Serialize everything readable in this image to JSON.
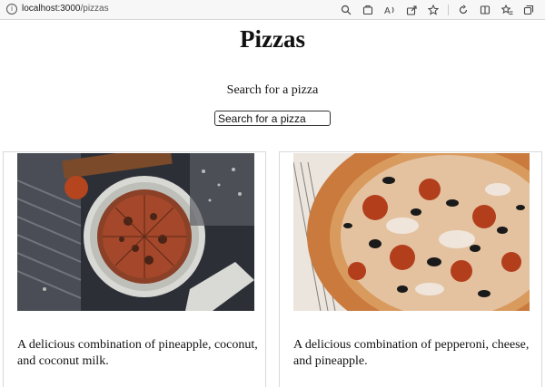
{
  "browser": {
    "url_host": "localhost:3000",
    "url_path": "/pizzas",
    "icons": [
      "zoom-icon",
      "extensions-icon",
      "read-aloud-icon",
      "share-icon",
      "favorite-icon",
      "refresh-icon",
      "split-screen-icon",
      "favorites-icon",
      "collections-icon"
    ]
  },
  "page": {
    "title": "Pizzas",
    "search_label": "Search for a pizza",
    "search_placeholder": "Search for a pizza",
    "search_value": ""
  },
  "pizzas": [
    {
      "description": "A delicious combination of pineapple, coconut, and coconut milk."
    },
    {
      "description": "A delicious combination of pepperoni, cheese, and pineapple."
    }
  ],
  "colors": {
    "background": "#ffffff",
    "text": "#111111",
    "card_border": "#d9d9d9"
  }
}
